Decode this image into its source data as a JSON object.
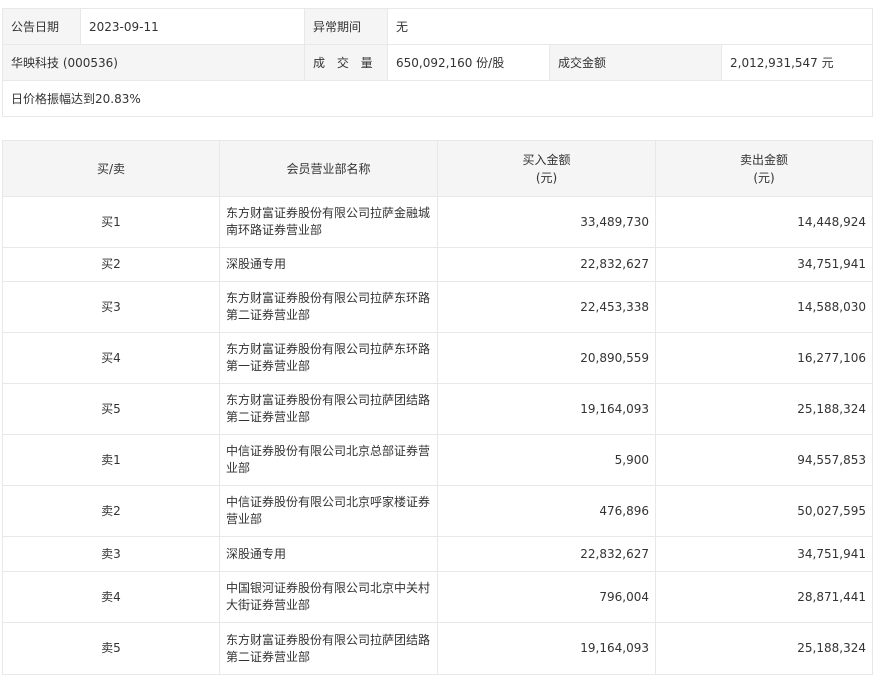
{
  "info": {
    "date_label": "公告日期",
    "date_value": "2023-09-11",
    "period_label": "异常期间",
    "period_value": "无",
    "stock": "华映科技 (000536)",
    "volume_label": "成 交 量",
    "volume_value": "650,092,160 份/股",
    "amount_label": "成交金额",
    "amount_value": "2,012,931,547 元",
    "reason": "日价格振幅达到20.83%"
  },
  "table": {
    "headers": {
      "side": "买/卖",
      "dept": "会员营业部名称",
      "buy_line1": "买入金额",
      "buy_line2": "(元)",
      "sell_line1": "卖出金额",
      "sell_line2": "(元)"
    },
    "rows": [
      {
        "side": "买1",
        "dept": "东方财富证券股份有限公司拉萨金融城南环路证券营业部",
        "buy": "33,489,730",
        "sell": "14,448,924"
      },
      {
        "side": "买2",
        "dept": "深股通专用",
        "buy": "22,832,627",
        "sell": "34,751,941"
      },
      {
        "side": "买3",
        "dept": "东方财富证券股份有限公司拉萨东环路第二证券营业部",
        "buy": "22,453,338",
        "sell": "14,588,030"
      },
      {
        "side": "买4",
        "dept": "东方财富证券股份有限公司拉萨东环路第一证券营业部",
        "buy": "20,890,559",
        "sell": "16,277,106"
      },
      {
        "side": "买5",
        "dept": "东方财富证券股份有限公司拉萨团结路第二证券营业部",
        "buy": "19,164,093",
        "sell": "25,188,324"
      },
      {
        "side": "卖1",
        "dept": "中信证券股份有限公司北京总部证券营业部",
        "buy": "5,900",
        "sell": "94,557,853"
      },
      {
        "side": "卖2",
        "dept": "中信证券股份有限公司北京呼家楼证券营业部",
        "buy": "476,896",
        "sell": "50,027,595"
      },
      {
        "side": "卖3",
        "dept": "深股通专用",
        "buy": "22,832,627",
        "sell": "34,751,941"
      },
      {
        "side": "卖4",
        "dept": "中国银河证券股份有限公司北京中关村大街证券营业部",
        "buy": "796,004",
        "sell": "28,871,441"
      },
      {
        "side": "卖5",
        "dept": "东方财富证券股份有限公司拉萨团结路第二证券营业部",
        "buy": "19,164,093",
        "sell": "25,188,324"
      }
    ]
  }
}
